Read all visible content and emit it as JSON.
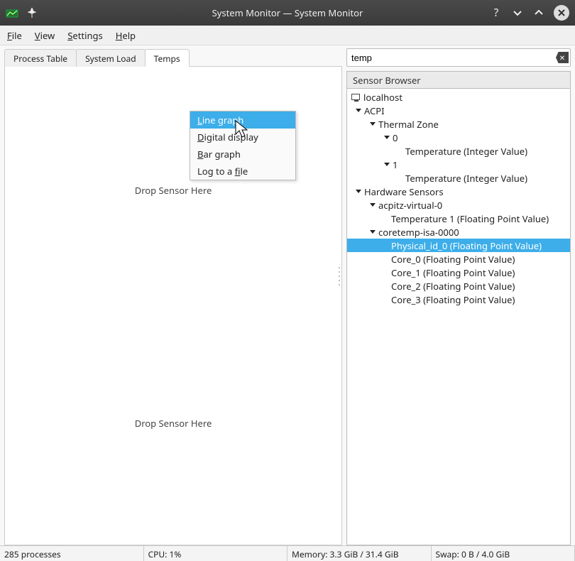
{
  "window": {
    "title": "System Monitor — System Monitor"
  },
  "menu": {
    "file": "File",
    "view": "View",
    "settings": "Settings",
    "help": "Help"
  },
  "tabs": {
    "process": "Process Table",
    "load": "System Load",
    "temps": "Temps"
  },
  "drop_text": "Drop Sensor Here",
  "context_menu": {
    "line": "Line graph",
    "digital": "Digital display",
    "bar": "Bar graph",
    "log": "Log to a file"
  },
  "search": {
    "value": "temp"
  },
  "browser_header": "Sensor Browser",
  "tree": {
    "localhost": "localhost",
    "acpi": "ACPI",
    "thermal_zone": "Thermal Zone",
    "zone0": "0",
    "temp_int": "Temperature (Integer Value)",
    "zone1": "1",
    "hw_sensors": "Hardware Sensors",
    "acpitz": "acpitz-virtual-0",
    "temp1_fp": "Temperature 1 (Floating Point Value)",
    "coretemp": "coretemp-isa-0000",
    "phys0": "Physical_id_0 (Floating Point Value)",
    "core0": "Core_0 (Floating Point Value)",
    "core1": "Core_1 (Floating Point Value)",
    "core2": "Core_2 (Floating Point Value)",
    "core3": "Core_3 (Floating Point Value)"
  },
  "status": {
    "procs": "285 processes",
    "cpu": "CPU: 1%",
    "mem": "Memory: 3.3 GiB / 31.4 GiB",
    "swap": "Swap: 0 B / 4.0 GiB"
  }
}
